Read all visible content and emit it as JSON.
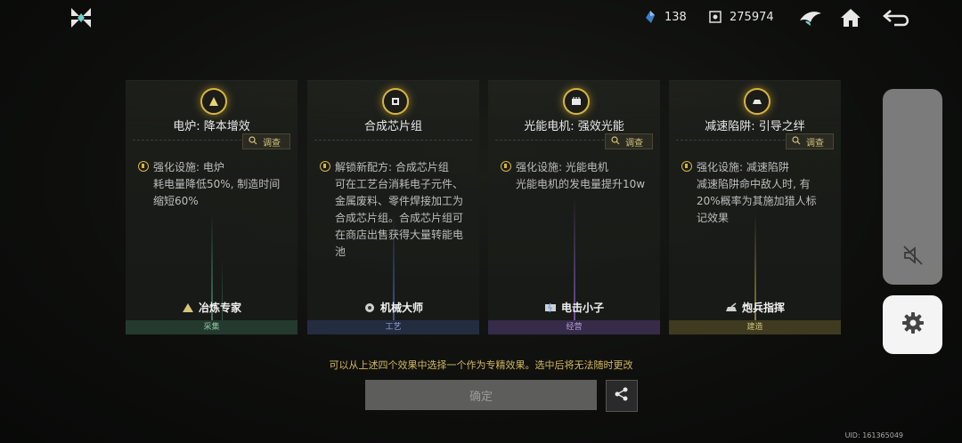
{
  "resources": [
    {
      "icon": "energy-crystal-icon",
      "value": "138"
    },
    {
      "icon": "currency-icon",
      "value": "275974"
    }
  ],
  "cards": [
    {
      "emblem": "smelting-emblem-icon",
      "title": "电炉: 降本增效",
      "inspect": "调查",
      "desc_lines": [
        "强化设施: 电炉",
        "耗电量降低50%, 制造时间",
        "缩短60%"
      ],
      "role": "冶炼专家",
      "category": "采集",
      "accent": "#4fa37a"
    },
    {
      "emblem": "chip-emblem-icon",
      "title": "合成芯片组",
      "inspect": "调查",
      "desc_lines": [
        "解锁新配方: 合成芯片组",
        "可在工艺台消耗电子元件、",
        "金属废料、零件焊接加工为",
        "合成芯片组。合成芯片组可",
        "在商店出售获得大量转能电",
        "池"
      ],
      "role": "机械大师",
      "category": "工艺",
      "accent": "#4b6fbf"
    },
    {
      "emblem": "motor-emblem-icon",
      "title": "光能电机: 强效光能",
      "inspect": "调查",
      "desc_lines": [
        "强化设施: 光能电机",
        "光能电机的发电量提升10w"
      ],
      "role": "电击小子",
      "category": "经营",
      "accent": "#8a5fc8"
    },
    {
      "emblem": "trap-emblem-icon",
      "title": "减速陷阱: 引导之绊",
      "inspect": "调查",
      "desc_lines": [
        "强化设施: 减速陷阱",
        "减速陷阱命中敌人时, 有",
        "20%概率为其施加猎人标",
        "记效果"
      ],
      "role": "炮兵指挥",
      "category": "建造",
      "accent": "#b7a44c"
    }
  ],
  "notice": "可以从上述四个效果中选择一个作为专精效果。选中后将无法随时更改",
  "confirm_label": "确定",
  "uid": "UID: 161365049",
  "colors": {
    "gold": "#d8b53a",
    "notice": "#d2b860"
  }
}
